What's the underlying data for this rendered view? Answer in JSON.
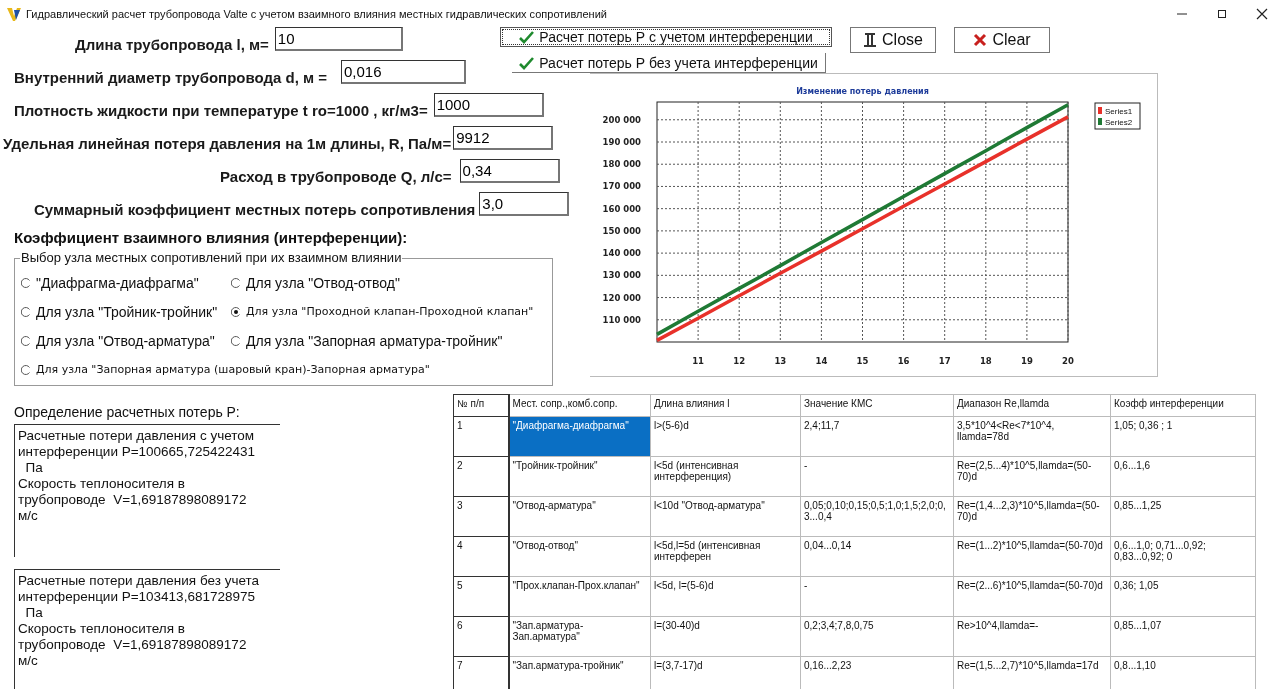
{
  "window": {
    "title": "Гидравлический расчет трубопровода Valte с учетом взаимного влияния местных гидравлических сопротивлений"
  },
  "fields": [
    {
      "label": "Длина трубопровода l, м=",
      "value": "10"
    },
    {
      "label": "Внутренний диаметр трубопровода  d, м =",
      "value": "0,016"
    },
    {
      "label": "Плотность жидкости при температуре t ro=1000 , кг/м3=",
      "value": "1000"
    },
    {
      "label": "Удельная линейная потеря давления на 1м длины, R, Па/м=",
      "value": "9912"
    },
    {
      "label": "Расход в трубопроводе Q, л/с=",
      "value": "0,34"
    },
    {
      "label": "Суммарный коэффициент местных потерь сопротивления",
      "value": "3,0"
    }
  ],
  "buttons": [
    {
      "kind": "check",
      "label": "Расчет потерь Р с учетом интерференции",
      "focused": true
    },
    {
      "kind": "check",
      "label": "Расчет потерь Р без учета  интерференции",
      "focused": false
    },
    {
      "kind": "close",
      "label": "Close",
      "focused": false
    },
    {
      "kind": "clear",
      "label": "Clear",
      "focused": false
    }
  ],
  "interference_heading": "Коэффициент взаимного влияния (интерференции):",
  "node_group": {
    "title": "Выбор узла местных сопротивлений при их взаимном влиянии",
    "options": [
      {
        "label": "\"Диафрагма-диафрагма\"",
        "kind": "normal",
        "selected": false
      },
      {
        "label": "Для узла \"Отвод-отвод\"",
        "kind": "normal",
        "selected": false
      },
      {
        "label": "Для узла \"Тройник-тройник\"",
        "kind": "normal",
        "selected": false
      },
      {
        "label": "Для узла \"Проходной клапан-Проходной клапан\"",
        "kind": "small",
        "selected": true
      },
      {
        "label": "Для узла \"Отвод-арматура\"",
        "kind": "normal",
        "selected": false
      },
      {
        "label": "Для узла \"Запорная арматура-тройник\"",
        "kind": "normal",
        "selected": false
      },
      {
        "label": "Для узла \"Запорная арматура (шаровый кран)-Запорная арматура\"",
        "kind": "small",
        "selected": false
      }
    ]
  },
  "chart": {
    "chart_data": {
      "type": "line",
      "title": "Изменение потерь  давления",
      "x": [
        10,
        11,
        12,
        13,
        14,
        15,
        16,
        17,
        18,
        19,
        20
      ],
      "series": [
        {
          "name": "Series1",
          "color": "#e8312a",
          "values": [
            100700,
            110700,
            120800,
            130900,
            140900,
            151000,
            161100,
            171100,
            181200,
            191300,
            201300
          ]
        },
        {
          "name": "Series2",
          "color": "#1f7a35",
          "values": [
            103400,
            113800,
            124100,
            134400,
            144800,
            155100,
            165500,
            175800,
            186100,
            196500,
            206800
          ]
        }
      ],
      "xlim": [
        10,
        20
      ],
      "ylim": [
        100000,
        208000
      ],
      "grid": true,
      "legend": true,
      "xticks": [
        11,
        12,
        13,
        14,
        15,
        16,
        17,
        18,
        19,
        20
      ],
      "yticks": [
        {
          "value": 110000,
          "label": "110 000"
        },
        {
          "value": 120000,
          "label": "120 000"
        },
        {
          "value": 130000,
          "label": "130 000"
        },
        {
          "value": 140000,
          "label": "140 000"
        },
        {
          "value": 150000,
          "label": "150 000"
        },
        {
          "value": 160000,
          "label": "160 000"
        },
        {
          "value": 170000,
          "label": "170 000"
        },
        {
          "value": 180000,
          "label": "180 000"
        },
        {
          "value": 190000,
          "label": "190 000"
        },
        {
          "value": 200000,
          "label": "200 000"
        }
      ]
    }
  },
  "results": {
    "label": "Определение расчетных потерь Р:",
    "boxes": [
      "Расчетные потери давления с учетом\nинтерференции Р=100665,725422431\n  Па\nСкорость теплоносителя в\nтрубопроводе  V=1,69187898089172\nм/с",
      "Расчетные потери давления без учета\nинтерференции Р=103413,681728975\n  Па\nСкорость теплоносителя в\nтрубопроводе  V=1,69187898089172\nм/с"
    ]
  },
  "table": {
    "columns": [
      "№ п/п",
      "Мест. сопр.,комб.сопр.",
      "Длина влияния l",
      "Значение КМС",
      "Диапазон Re,llamda",
      "Коэфф интерференции"
    ],
    "rows": [
      {
        "selected": true,
        "cells": [
          "1",
          "\"Диафрагма-диафрагма\"",
          "l>(5-6)d",
          "2,4;11,7",
          "3,5*10^4<Re<7*10^4, llamda=78d",
          "1,05; 0,36 ; 1"
        ]
      },
      {
        "selected": false,
        "cells": [
          "2",
          "\"Тройник-тройник\"",
          "l<5d (интенсивная интерференция)",
          "-",
          "Re=(2,5...4)*10^5,llamda=(50-70)d",
          "0,6...1,6"
        ]
      },
      {
        "selected": false,
        "cells": [
          "3",
          "\"Отвод-арматура\"",
          "l<10d \"Отвод-арматура\"",
          "0,05;0,10;0,15;0,5;1,0;1,5;2,0;0,3...0,4",
          "Re=(1,4...2,3)*10^5,llamda=(50-70)d",
          "0,85...1,25"
        ]
      },
      {
        "selected": false,
        "cells": [
          "4",
          "\"Отвод-отвод\"",
          "l<5d,l=5d (интенсивная интерферен",
          "0,04...0,14",
          "Re=(1...2)*10^5,llamda=(50-70)d",
          "0,6...1,0; 0,71...0,92; 0,83...0,92; 0"
        ]
      },
      {
        "selected": false,
        "cells": [
          "5",
          "\"Прох.клапан-Прох.клапан\"",
          "l<5d, l=(5-6)d",
          "-",
          "Re=(2...6)*10^5,llamda=(50-70)d",
          "0,36; 1,05"
        ]
      },
      {
        "selected": false,
        "cells": [
          "6",
          "\"Зап.арматура-Зап.арматура\"",
          "l=(30-40)d",
          "0,2;3,4;7,8,0,75",
          "Re>10^4,llamda=-",
          "0,85...1,07"
        ]
      },
      {
        "selected": false,
        "cells": [
          "7",
          "\"Зап.арматура-тройник\"",
          "l=(3,7-17)d",
          "0,16...2,23",
          "Re=(1,5...2,7)*10^5,llamda=17d",
          "0,8...1,10"
        ]
      }
    ]
  }
}
